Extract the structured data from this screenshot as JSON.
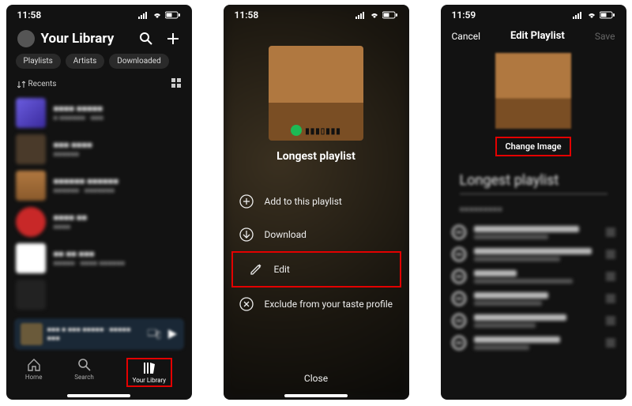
{
  "status": {
    "time1": "11:58",
    "time2": "11:58",
    "time3": "11:59"
  },
  "screen1": {
    "title": "Your Library",
    "chips": [
      "Playlists",
      "Artists",
      "Downloaded"
    ],
    "sort_label": "Recents",
    "nav": {
      "home": "Home",
      "search": "Search",
      "library": "Your Library"
    }
  },
  "screen2": {
    "playlist_title": "Longest playlist",
    "menu": {
      "add": "Add to this playlist",
      "download": "Download",
      "edit": "Edit",
      "exclude": "Exclude from your taste profile",
      "close": "Close"
    }
  },
  "screen3": {
    "cancel": "Cancel",
    "title": "Edit Playlist",
    "save": "Save",
    "change_image": "Change Image",
    "playlist_name": "Longest playlist"
  }
}
